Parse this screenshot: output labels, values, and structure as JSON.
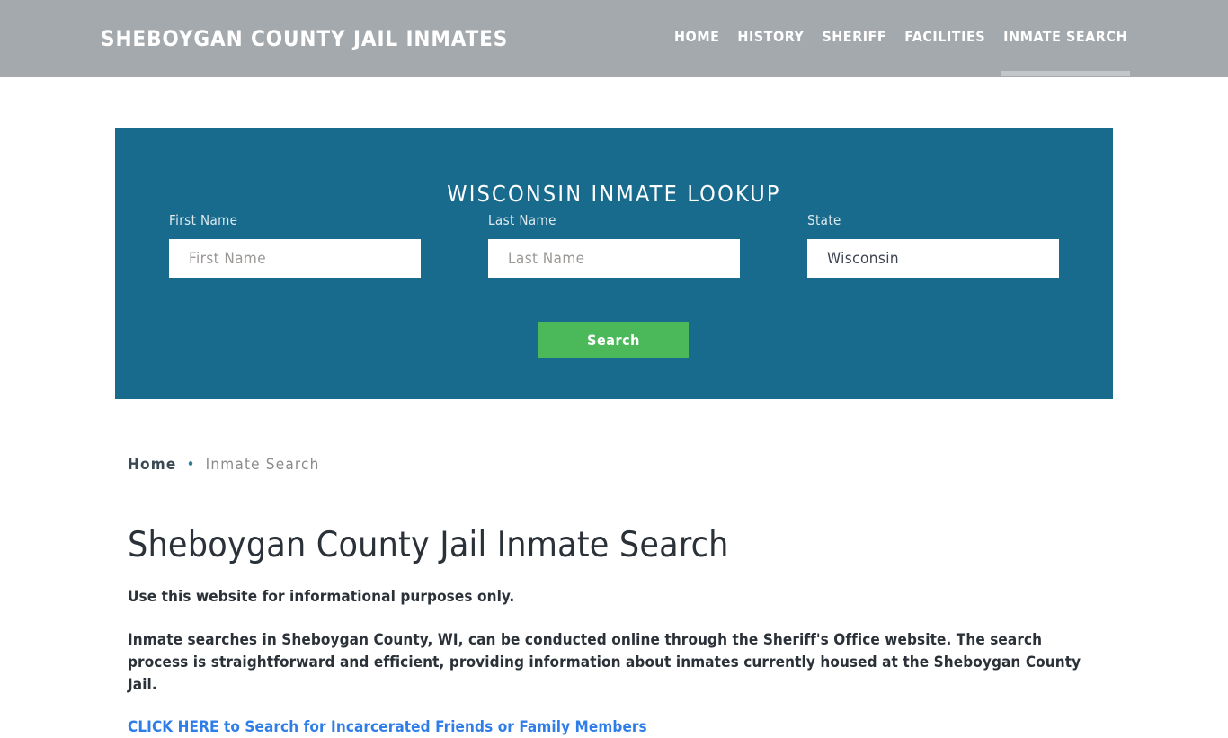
{
  "header": {
    "brand": "SHEBOYGAN COUNTY JAIL INMATES",
    "brand_color": "#ffffff",
    "background_color": "#a4a9ad",
    "nav": [
      {
        "label": "HOME",
        "active": false
      },
      {
        "label": "HISTORY",
        "active": false
      },
      {
        "label": "SHERIFF",
        "active": false
      },
      {
        "label": "FACILITIES",
        "active": false
      },
      {
        "label": "INMATE SEARCH",
        "active": true
      }
    ]
  },
  "search_panel": {
    "title": "WISCONSIN INMATE LOOKUP",
    "background_color": "#196b8e",
    "fields": [
      {
        "label": "First Name",
        "placeholder": "First Name",
        "value": ""
      },
      {
        "label": "Last Name",
        "placeholder": "Last Name",
        "value": ""
      },
      {
        "label": "State",
        "placeholder": "State",
        "value": "Wisconsin"
      }
    ],
    "submit_label": "Search",
    "submit_color": "#4bb85a"
  },
  "breadcrumb": {
    "home_label": "Home",
    "separator": "•",
    "current_label": "Inmate Search"
  },
  "main": {
    "page_title": "Sheboygan County Jail Inmate Search",
    "lead": "Use this website for informational purposes only.",
    "paragraph": "Inmate searches in Sheboygan County, WI, can be conducted online through the Sheriff's Office website. The search process is straightforward and efficient, providing information about inmates currently housed at the Sheboygan County Jail.",
    "cta_link": "CLICK HERE to Search for Incarcerated Friends or Family Members",
    "cta_link_color": "#2f7de9"
  }
}
